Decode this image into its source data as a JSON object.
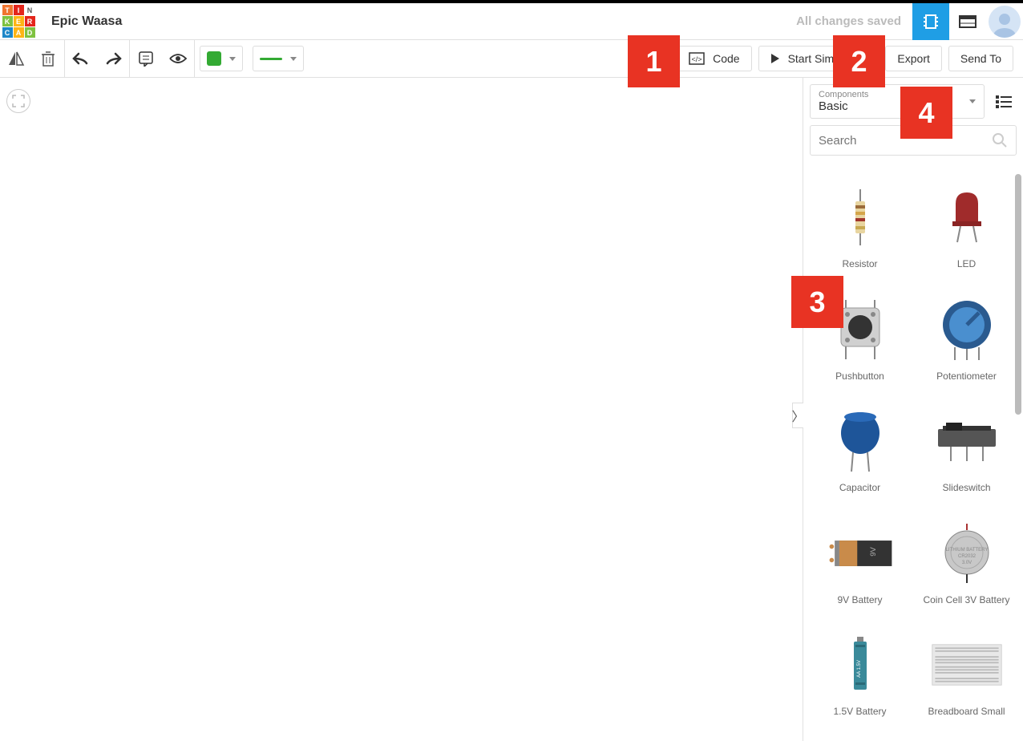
{
  "header": {
    "project_name": "Epic Waasa",
    "save_status": "All changes saved",
    "logo_cells": [
      "T",
      "I",
      "N",
      "K",
      "E",
      "R",
      "C",
      "A",
      "D"
    ]
  },
  "toolbar": {
    "code_label": "Code",
    "simulate_label": "Start Simulation",
    "export_label": "Export",
    "send_label": "Send To"
  },
  "panel": {
    "components_label": "Components",
    "components_value": "Basic",
    "search_placeholder": "Search",
    "items": [
      {
        "label": "Resistor"
      },
      {
        "label": "LED"
      },
      {
        "label": "Pushbutton"
      },
      {
        "label": "Potentiometer"
      },
      {
        "label": "Capacitor"
      },
      {
        "label": "Slideswitch"
      },
      {
        "label": "9V Battery"
      },
      {
        "label": "Coin Cell 3V Battery"
      },
      {
        "label": "1.5V Battery"
      },
      {
        "label": "Breadboard Small"
      }
    ]
  },
  "markers": {
    "m1": "1",
    "m2": "2",
    "m3": "3",
    "m4": "4"
  }
}
